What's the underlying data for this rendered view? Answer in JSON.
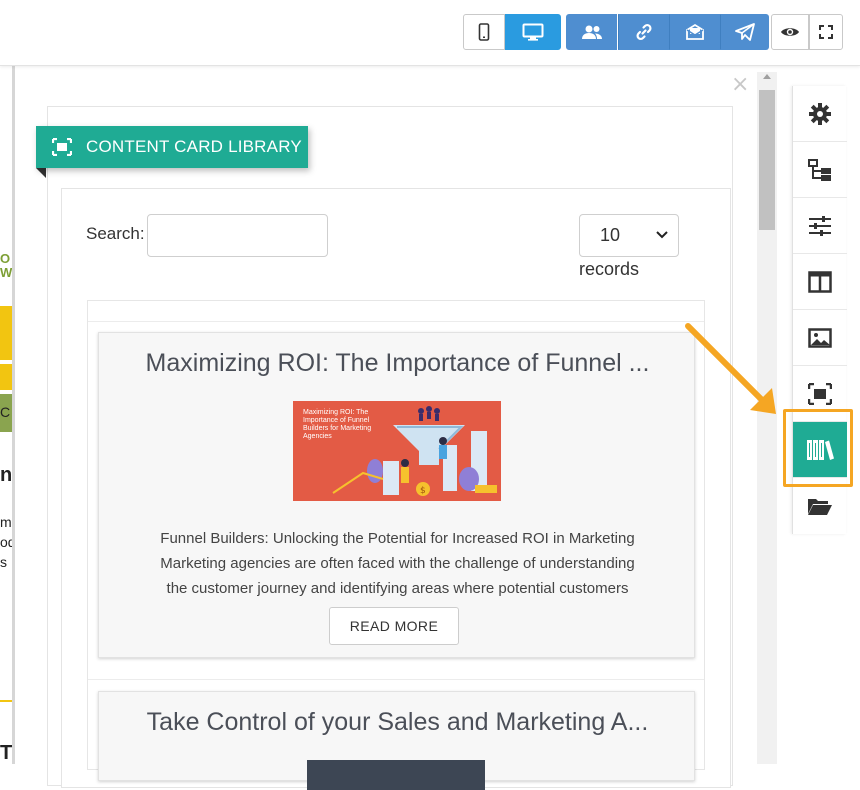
{
  "toolbar": {
    "buttons": [
      {
        "name": "mobile-view",
        "icon": "mobile-icon"
      },
      {
        "name": "desktop-view",
        "icon": "desktop-icon",
        "active": true
      },
      {
        "name": "users",
        "icon": "users-icon"
      },
      {
        "name": "link",
        "icon": "link-icon"
      },
      {
        "name": "email",
        "icon": "email-icon"
      },
      {
        "name": "send",
        "icon": "paper-plane-icon"
      },
      {
        "name": "preview",
        "icon": "eye-icon"
      },
      {
        "name": "fullscreen",
        "icon": "expand-icon"
      }
    ],
    "accent_active": "#2a9be0",
    "accent_group": "#4f8ed0"
  },
  "panel": {
    "close_glyph": "×",
    "banner_title": "CONTENT CARD LIBRARY",
    "banner_color": "#1fab94",
    "search": {
      "label": "Search:",
      "value": "",
      "placeholder": ""
    },
    "records": {
      "selected": "10",
      "label": "records"
    },
    "items": [
      {
        "title": "Maximizing ROI: The Importance of Funnel ...",
        "thumbnail_text": "Maximizing ROI: The Importance of Funnel Builders for Marketing Agencies",
        "description_lines": [
          "Funnel Builders: Unlocking the Potential for Increased ROI in Marketing",
          "Marketing agencies are often faced with the challenge of understanding",
          "the customer journey and identifying areas where potential customers"
        ],
        "button": "READ MORE"
      },
      {
        "title": "Take Control of your Sales and Marketing A..."
      }
    ]
  },
  "left_page": {
    "fragments": [
      "O",
      "WI",
      "C",
      "ne",
      "me",
      "od",
      "s",
      "Th"
    ]
  },
  "sidebar": {
    "buttons": [
      {
        "icon": "gear-icon"
      },
      {
        "icon": "sitemap-icon"
      },
      {
        "icon": "sliders-icon"
      },
      {
        "icon": "columns-icon"
      },
      {
        "icon": "image-icon"
      },
      {
        "icon": "content-card-icon"
      },
      {
        "icon": "library-books-icon",
        "active": true
      },
      {
        "icon": "folder-open-icon"
      }
    ],
    "active_color": "#1fab94",
    "highlight_color": "#f5a623"
  }
}
